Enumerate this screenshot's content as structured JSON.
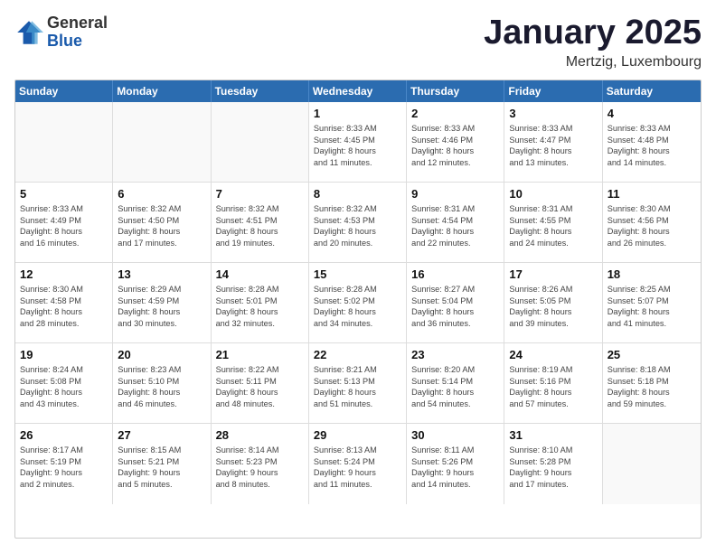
{
  "logo": {
    "general": "General",
    "blue": "Blue"
  },
  "header": {
    "month": "January 2025",
    "location": "Mertzig, Luxembourg"
  },
  "weekdays": [
    "Sunday",
    "Monday",
    "Tuesday",
    "Wednesday",
    "Thursday",
    "Friday",
    "Saturday"
  ],
  "rows": [
    [
      {
        "day": "",
        "text": "",
        "empty": true
      },
      {
        "day": "",
        "text": "",
        "empty": true
      },
      {
        "day": "",
        "text": "",
        "empty": true
      },
      {
        "day": "1",
        "text": "Sunrise: 8:33 AM\nSunset: 4:45 PM\nDaylight: 8 hours\nand 11 minutes."
      },
      {
        "day": "2",
        "text": "Sunrise: 8:33 AM\nSunset: 4:46 PM\nDaylight: 8 hours\nand 12 minutes."
      },
      {
        "day": "3",
        "text": "Sunrise: 8:33 AM\nSunset: 4:47 PM\nDaylight: 8 hours\nand 13 minutes."
      },
      {
        "day": "4",
        "text": "Sunrise: 8:33 AM\nSunset: 4:48 PM\nDaylight: 8 hours\nand 14 minutes."
      }
    ],
    [
      {
        "day": "5",
        "text": "Sunrise: 8:33 AM\nSunset: 4:49 PM\nDaylight: 8 hours\nand 16 minutes."
      },
      {
        "day": "6",
        "text": "Sunrise: 8:32 AM\nSunset: 4:50 PM\nDaylight: 8 hours\nand 17 minutes."
      },
      {
        "day": "7",
        "text": "Sunrise: 8:32 AM\nSunset: 4:51 PM\nDaylight: 8 hours\nand 19 minutes."
      },
      {
        "day": "8",
        "text": "Sunrise: 8:32 AM\nSunset: 4:53 PM\nDaylight: 8 hours\nand 20 minutes."
      },
      {
        "day": "9",
        "text": "Sunrise: 8:31 AM\nSunset: 4:54 PM\nDaylight: 8 hours\nand 22 minutes."
      },
      {
        "day": "10",
        "text": "Sunrise: 8:31 AM\nSunset: 4:55 PM\nDaylight: 8 hours\nand 24 minutes."
      },
      {
        "day": "11",
        "text": "Sunrise: 8:30 AM\nSunset: 4:56 PM\nDaylight: 8 hours\nand 26 minutes."
      }
    ],
    [
      {
        "day": "12",
        "text": "Sunrise: 8:30 AM\nSunset: 4:58 PM\nDaylight: 8 hours\nand 28 minutes."
      },
      {
        "day": "13",
        "text": "Sunrise: 8:29 AM\nSunset: 4:59 PM\nDaylight: 8 hours\nand 30 minutes."
      },
      {
        "day": "14",
        "text": "Sunrise: 8:28 AM\nSunset: 5:01 PM\nDaylight: 8 hours\nand 32 minutes."
      },
      {
        "day": "15",
        "text": "Sunrise: 8:28 AM\nSunset: 5:02 PM\nDaylight: 8 hours\nand 34 minutes."
      },
      {
        "day": "16",
        "text": "Sunrise: 8:27 AM\nSunset: 5:04 PM\nDaylight: 8 hours\nand 36 minutes."
      },
      {
        "day": "17",
        "text": "Sunrise: 8:26 AM\nSunset: 5:05 PM\nDaylight: 8 hours\nand 39 minutes."
      },
      {
        "day": "18",
        "text": "Sunrise: 8:25 AM\nSunset: 5:07 PM\nDaylight: 8 hours\nand 41 minutes."
      }
    ],
    [
      {
        "day": "19",
        "text": "Sunrise: 8:24 AM\nSunset: 5:08 PM\nDaylight: 8 hours\nand 43 minutes."
      },
      {
        "day": "20",
        "text": "Sunrise: 8:23 AM\nSunset: 5:10 PM\nDaylight: 8 hours\nand 46 minutes."
      },
      {
        "day": "21",
        "text": "Sunrise: 8:22 AM\nSunset: 5:11 PM\nDaylight: 8 hours\nand 48 minutes."
      },
      {
        "day": "22",
        "text": "Sunrise: 8:21 AM\nSunset: 5:13 PM\nDaylight: 8 hours\nand 51 minutes."
      },
      {
        "day": "23",
        "text": "Sunrise: 8:20 AM\nSunset: 5:14 PM\nDaylight: 8 hours\nand 54 minutes."
      },
      {
        "day": "24",
        "text": "Sunrise: 8:19 AM\nSunset: 5:16 PM\nDaylight: 8 hours\nand 57 minutes."
      },
      {
        "day": "25",
        "text": "Sunrise: 8:18 AM\nSunset: 5:18 PM\nDaylight: 8 hours\nand 59 minutes."
      }
    ],
    [
      {
        "day": "26",
        "text": "Sunrise: 8:17 AM\nSunset: 5:19 PM\nDaylight: 9 hours\nand 2 minutes."
      },
      {
        "day": "27",
        "text": "Sunrise: 8:15 AM\nSunset: 5:21 PM\nDaylight: 9 hours\nand 5 minutes."
      },
      {
        "day": "28",
        "text": "Sunrise: 8:14 AM\nSunset: 5:23 PM\nDaylight: 9 hours\nand 8 minutes."
      },
      {
        "day": "29",
        "text": "Sunrise: 8:13 AM\nSunset: 5:24 PM\nDaylight: 9 hours\nand 11 minutes."
      },
      {
        "day": "30",
        "text": "Sunrise: 8:11 AM\nSunset: 5:26 PM\nDaylight: 9 hours\nand 14 minutes."
      },
      {
        "day": "31",
        "text": "Sunrise: 8:10 AM\nSunset: 5:28 PM\nDaylight: 9 hours\nand 17 minutes."
      },
      {
        "day": "",
        "text": "",
        "empty": true
      }
    ]
  ]
}
